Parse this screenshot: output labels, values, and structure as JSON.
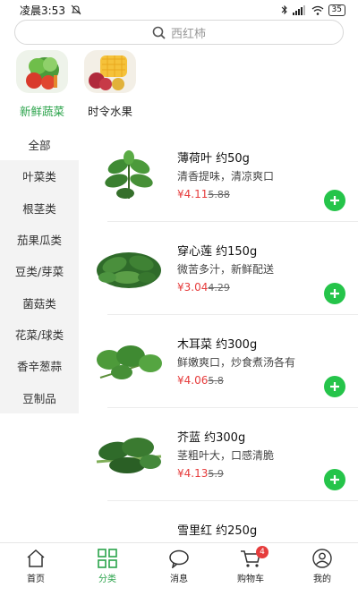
{
  "status_bar": {
    "time": "凌晨3:53",
    "battery": "35"
  },
  "search": {
    "placeholder": "西红柿"
  },
  "top_categories": [
    {
      "label": "新鲜蔬菜",
      "active": true
    },
    {
      "label": "时令水果",
      "active": false
    }
  ],
  "sidebar": {
    "items": [
      {
        "label": "全部",
        "active": true
      },
      {
        "label": "叶菜类",
        "active": false
      },
      {
        "label": "根茎类",
        "active": false
      },
      {
        "label": "茄果瓜类",
        "active": false
      },
      {
        "label": "豆类/芽菜",
        "active": false
      },
      {
        "label": "菌菇类",
        "active": false
      },
      {
        "label": "花菜/球类",
        "active": false
      },
      {
        "label": "香辛葱蒜",
        "active": false
      },
      {
        "label": "豆制品",
        "active": false
      }
    ]
  },
  "products": [
    {
      "name": "薄荷叶 约50g",
      "desc": "清香提味，清凉爽口",
      "price": "¥4.11",
      "orig": "5.88"
    },
    {
      "name": "穿心莲 约150g",
      "desc": "微苦多汁，新鲜配送",
      "price": "¥3.04",
      "orig": "4.29"
    },
    {
      "name": "木耳菜 约300g",
      "desc": "鲜嫩爽口，炒食煮汤各有",
      "price": "¥4.06",
      "orig": "5.8"
    },
    {
      "name": "芥蓝 约300g",
      "desc": "茎粗叶大，口感清脆",
      "price": "¥4.13",
      "orig": "5.9"
    },
    {
      "name": "雪里红 约250g",
      "desc": "",
      "price": "",
      "orig": ""
    }
  ],
  "tabbar": {
    "items": [
      {
        "label": "首页",
        "icon": "home-icon"
      },
      {
        "label": "分类",
        "icon": "category-icon",
        "active": true
      },
      {
        "label": "消息",
        "icon": "message-icon"
      },
      {
        "label": "购物车",
        "icon": "cart-icon",
        "badge": "4"
      },
      {
        "label": "我的",
        "icon": "profile-icon"
      }
    ]
  },
  "colors": {
    "accent": "#2aa34a",
    "price": "#e63c3c",
    "add_button": "#25c44a"
  }
}
